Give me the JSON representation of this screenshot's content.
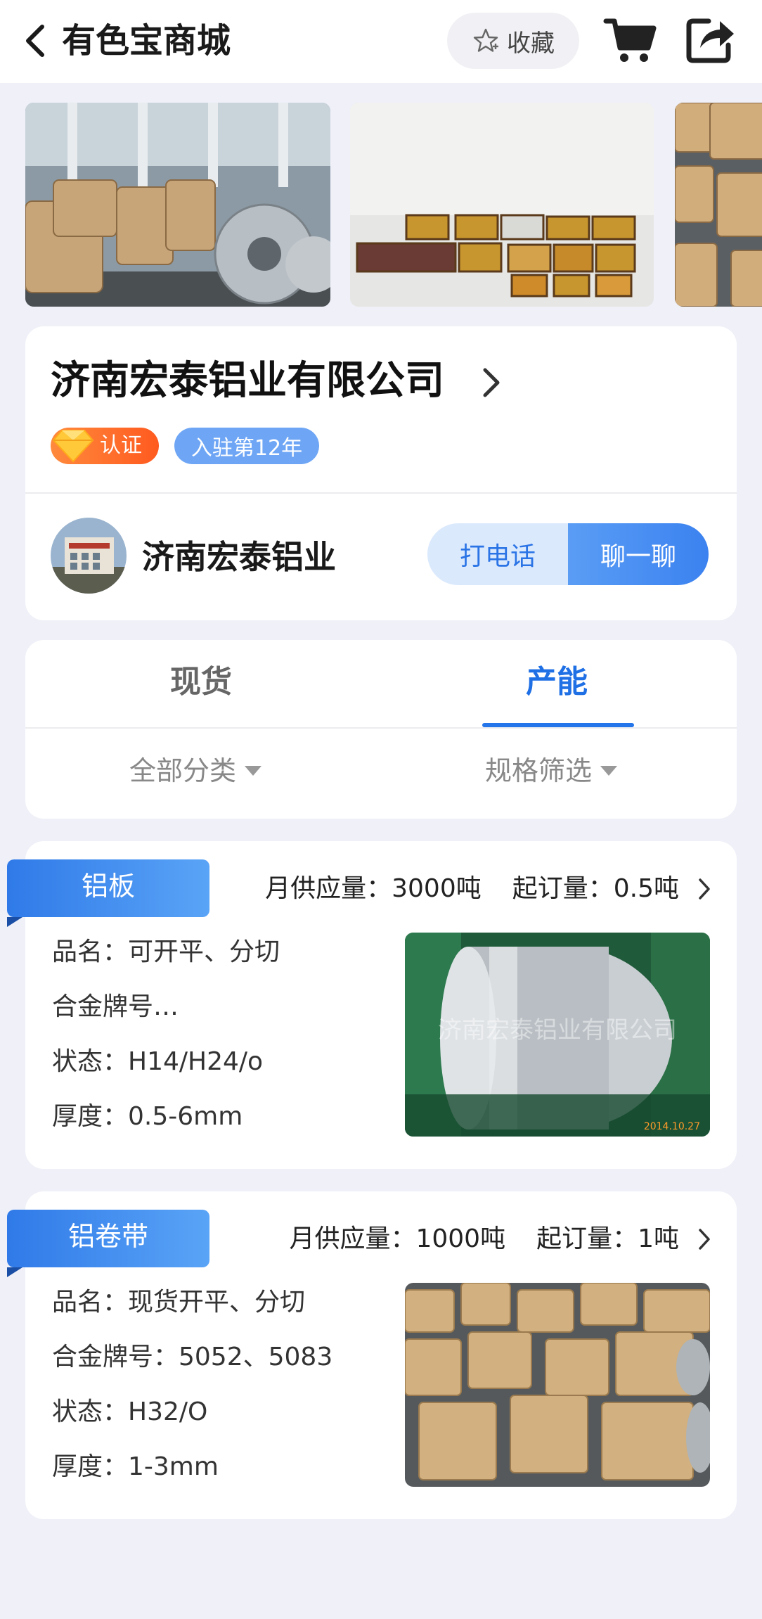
{
  "header": {
    "title": "有色宝商城",
    "favorite_label": "收藏"
  },
  "company": {
    "name": "济南宏泰铝业有限公司",
    "cert_badge": "认证",
    "years_badge": "入驻第12年",
    "short_name": "济南宏泰铝业",
    "call_label": "打电话",
    "chat_label": "聊一聊"
  },
  "tabs": {
    "items": [
      {
        "label": "现货",
        "active": false
      },
      {
        "label": "产能",
        "active": true
      }
    ],
    "filters": [
      {
        "label": "全部分类"
      },
      {
        "label": "规格筛选"
      }
    ]
  },
  "products": [
    {
      "category": "铝板",
      "monthly_supply": "月供应量：3000吨",
      "min_order": "起订量：0.5吨",
      "specs": [
        "品名：可开平、分切",
        "合金牌号…",
        "状态：H14/H24/o",
        "厚度：0.5-6mm"
      ],
      "photo_watermark": "济南宏泰铝业有限公司",
      "photo_date": "2014.10.27"
    },
    {
      "category": "铝卷带",
      "monthly_supply": "月供应量：1000吨",
      "min_order": "起订量：1吨",
      "specs": [
        "品名：现货开平、分切",
        "合金牌号：5052、5083",
        "状态：H32/O",
        "厚度：1-3mm"
      ]
    }
  ],
  "colors": {
    "accent": "#2575ea",
    "background": "#eff0f8",
    "badge_orange": "#ff6a2a",
    "badge_blue": "#6ea6f5"
  }
}
